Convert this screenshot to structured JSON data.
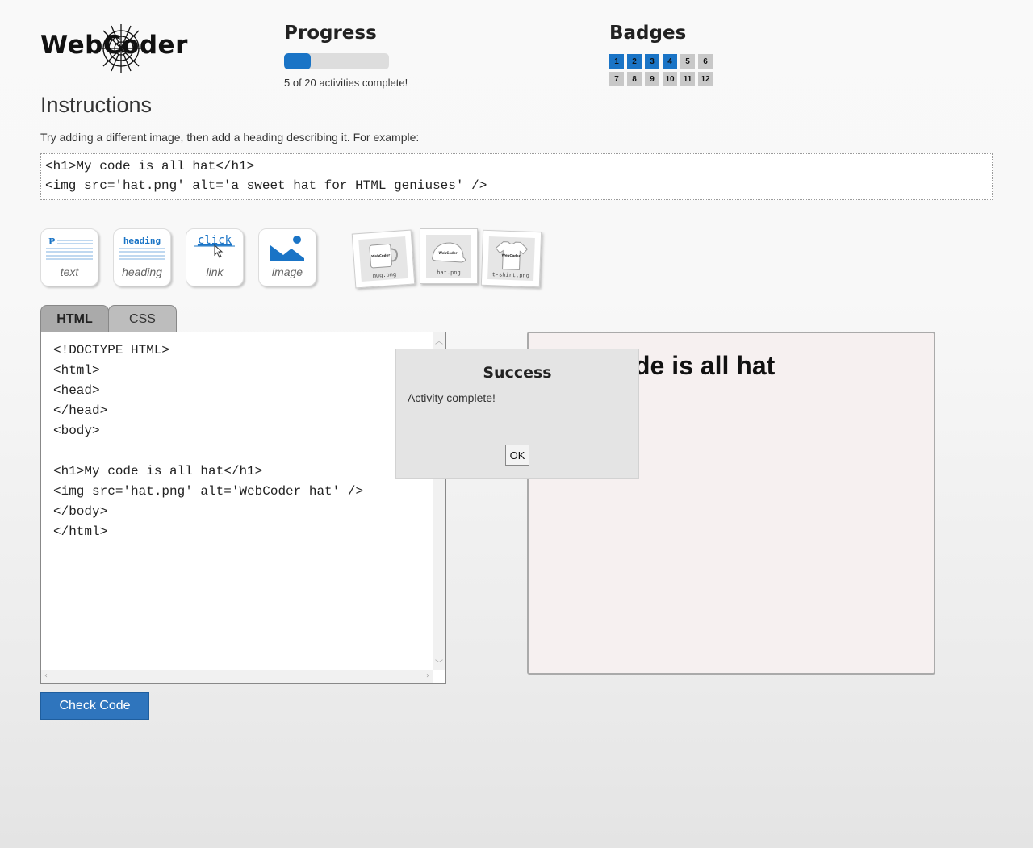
{
  "logo": {
    "text": "WebCoder"
  },
  "progress": {
    "title": "Progress",
    "completed": 5,
    "total": 20,
    "fraction": 0.25,
    "text": "5 of 20 activities complete!"
  },
  "badges": {
    "title": "Badges",
    "items": [
      {
        "label": "1",
        "earned": true
      },
      {
        "label": "2",
        "earned": true
      },
      {
        "label": "3",
        "earned": true
      },
      {
        "label": "4",
        "earned": true
      },
      {
        "label": "5",
        "earned": false
      },
      {
        "label": "6",
        "earned": false
      },
      {
        "label": "7",
        "earned": false
      },
      {
        "label": "8",
        "earned": false
      },
      {
        "label": "9",
        "earned": false
      },
      {
        "label": "10",
        "earned": false
      },
      {
        "label": "11",
        "earned": false
      },
      {
        "label": "12",
        "earned": false
      }
    ]
  },
  "instructions": {
    "title": "Instructions",
    "text": "Try adding a different image, then add a heading describing it. For example:",
    "example_lines": [
      "<h1>My code is all hat</h1>",
      "<img src='hat.png' alt='a sweet hat for HTML geniuses' />"
    ]
  },
  "tools": {
    "text": {
      "label": "text",
      "art": "P"
    },
    "heading": {
      "label": "heading",
      "art": "heading"
    },
    "link": {
      "label": "link",
      "art": "click"
    },
    "image": {
      "label": "image"
    }
  },
  "products": {
    "mug": {
      "caption": "mug.png",
      "brand": "WebCoder"
    },
    "hat": {
      "caption": "hat.png",
      "brand": "WebCoder"
    },
    "tshirt": {
      "caption": "t-shirt.png",
      "brand": "WebCoder"
    }
  },
  "tabs": {
    "html": "HTML",
    "css": "CSS"
  },
  "editor": {
    "code": "<!DOCTYPE HTML>\n<html>\n<head>\n</head>\n<body>\n\n<h1>My code is all hat</h1>\n<img src='hat.png' alt='WebCoder hat' />\n</body>\n</html>"
  },
  "preview": {
    "heading_visible": "de is all hat"
  },
  "check_button": "Check Code",
  "modal": {
    "title": "Success",
    "message": "Activity complete!",
    "ok": "OK"
  },
  "colors": {
    "accent": "#1a74c6",
    "button": "#2f75bd"
  }
}
